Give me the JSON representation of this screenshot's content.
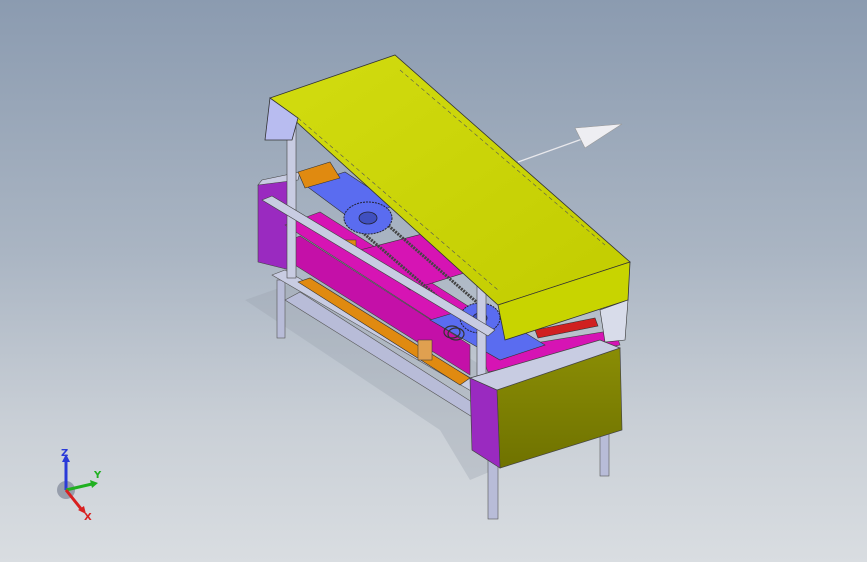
{
  "viewport": {
    "background_top": "#8b9bb0",
    "background_bottom": "#d9dde1"
  },
  "model": {
    "colors": {
      "top_panel": "#c8d400",
      "side_panel": "#7f8200",
      "frame": "#b8bcd8",
      "magenta": "#d614b4",
      "purple": "#9a2ac0",
      "blue": "#5a6cf0",
      "orange": "#e08a10",
      "red": "#d02020",
      "gear": "#5a6cf0"
    }
  },
  "triad": {
    "z_label": "Z",
    "y_label": "Y",
    "x_label": "X",
    "z_color": "#2a3ad8",
    "y_color": "#20b020",
    "x_color": "#d82020"
  }
}
